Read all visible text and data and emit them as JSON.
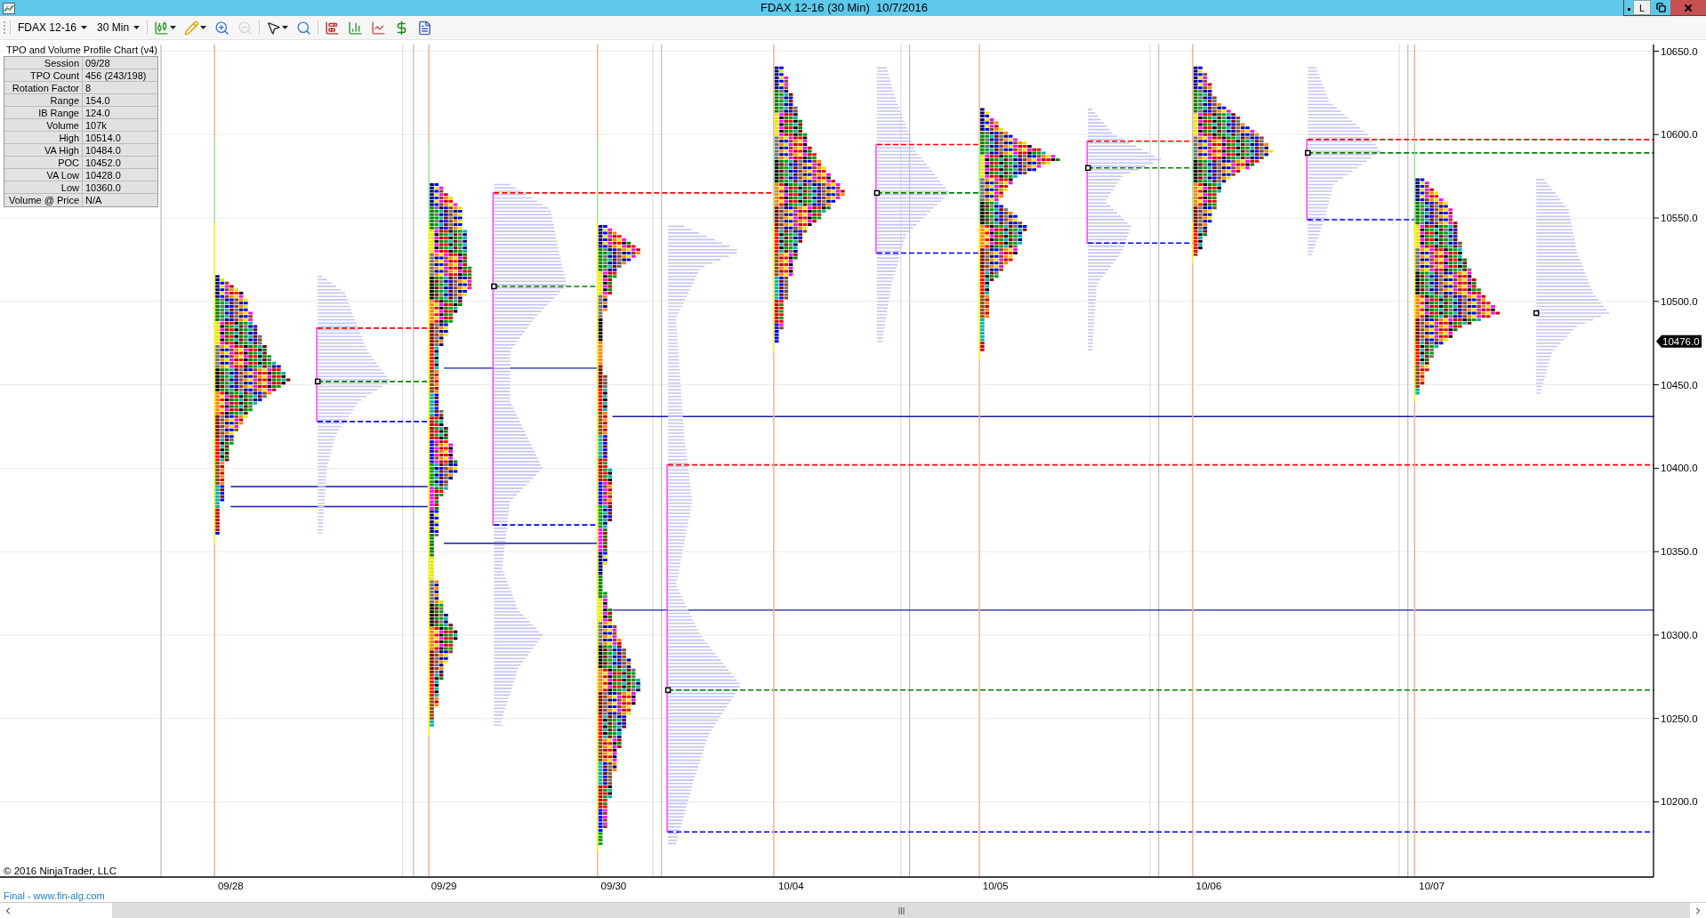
{
  "window": {
    "title": "FDAX 12-16 (30 Min)  10/7/2016",
    "button_label": "L"
  },
  "toolbar": {
    "instrument": "FDAX 12-16",
    "interval": "30 Min",
    "tools": [
      {
        "kind": "candles",
        "dropdown": true,
        "disabled": false
      },
      {
        "kind": "pencil",
        "dropdown": true,
        "disabled": false
      },
      {
        "kind": "zoom-in",
        "dropdown": false,
        "disabled": false
      },
      {
        "kind": "zoom-out",
        "dropdown": false,
        "disabled": true
      },
      {
        "kind": "pointer",
        "dropdown": true,
        "disabled": false
      },
      {
        "kind": "magnifier",
        "dropdown": false,
        "disabled": false
      },
      {
        "kind": "bars",
        "dropdown": false,
        "disabled": false
      },
      {
        "kind": "columns",
        "dropdown": false,
        "disabled": false
      },
      {
        "kind": "chart",
        "dropdown": false,
        "disabled": false
      },
      {
        "kind": "dollar",
        "dropdown": false,
        "disabled": false
      },
      {
        "kind": "properties",
        "dropdown": false,
        "disabled": false
      }
    ]
  },
  "info_panel": {
    "title": "TPO and Volume Profile Chart (v4)",
    "rows": [
      {
        "label": "Session",
        "value": "09/28"
      },
      {
        "label": "TPO Count",
        "value": "456 (243/198)"
      },
      {
        "label": "Rotation Factor",
        "value": "8"
      },
      {
        "label": "Range",
        "value": "154.0"
      },
      {
        "label": "IB Range",
        "value": "124.0"
      },
      {
        "label": "Volume",
        "value": "107k"
      },
      {
        "label": "High",
        "value": "10514.0"
      },
      {
        "label": "VA High",
        "value": "10484.0"
      },
      {
        "label": "POC",
        "value": "10452.0"
      },
      {
        "label": "VA Low",
        "value": "10428.0"
      },
      {
        "label": "Low",
        "value": "10360.0"
      },
      {
        "label": "Volume @ Price",
        "value": "N/A"
      }
    ]
  },
  "price_axis": {
    "labels": [
      "10650.0",
      "10600.0",
      "10550.0",
      "10500.0",
      "10450.0",
      "10400.0",
      "10350.0",
      "10300.0",
      "10250.0",
      "10200.0"
    ],
    "current_price": "10476.0"
  },
  "date_axis": {
    "labels": [
      "09/28",
      "09/29",
      "09/30",
      "10/04",
      "10/05",
      "10/06",
      "10/07"
    ]
  },
  "copyright": "© 2016 NinjaTrader, LLC",
  "footer_link": "Final - www.fin-alg.com"
}
